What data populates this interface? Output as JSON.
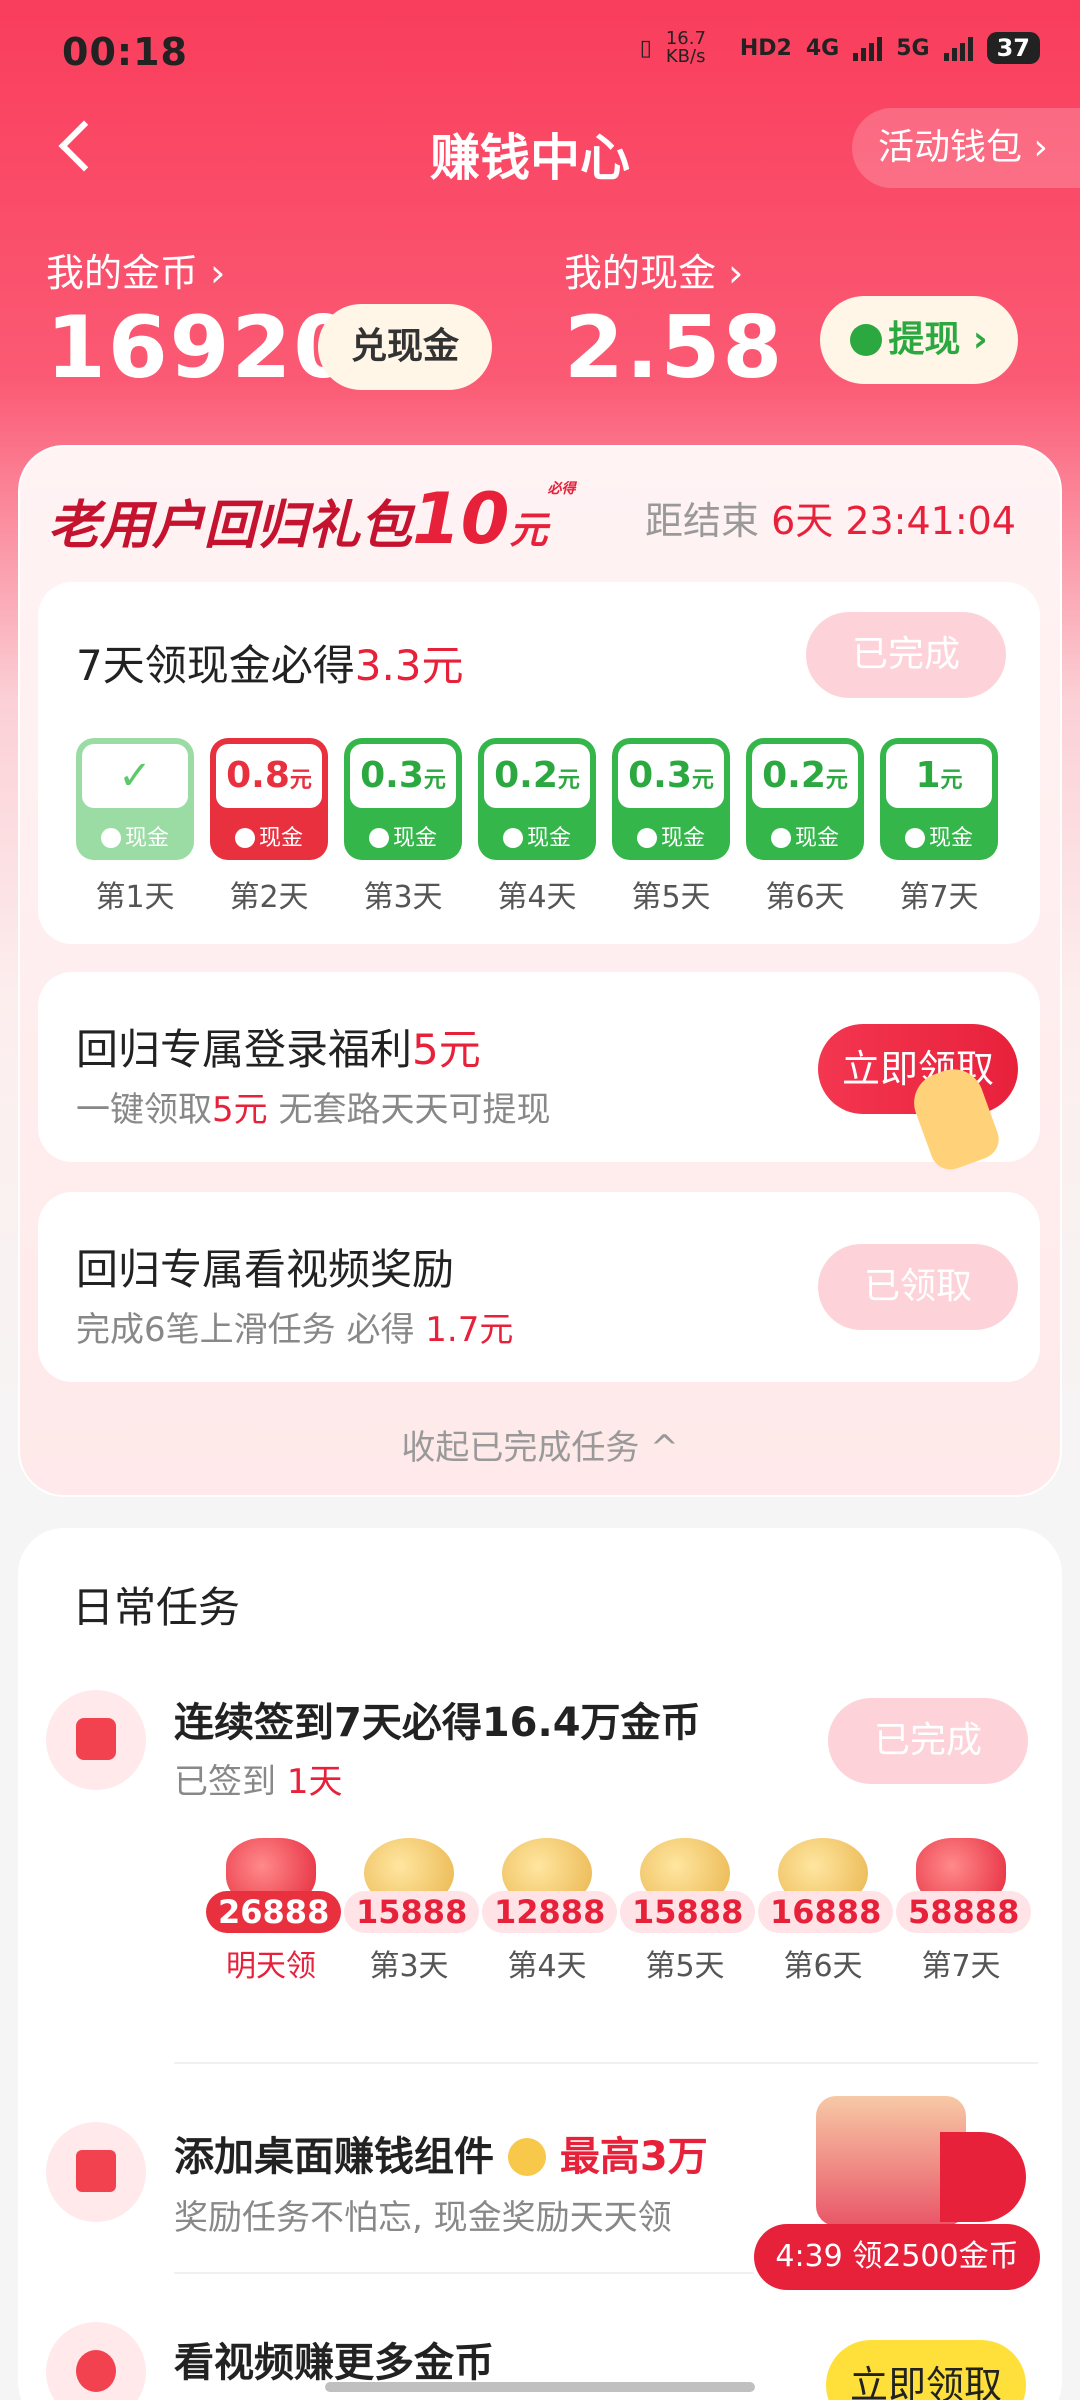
{
  "status_bar": {
    "time": "00:18",
    "net_speed": "16.7 KB/s",
    "hd": "HD2",
    "net1": "4G",
    "net2": "5G",
    "battery": "37"
  },
  "header": {
    "title": "赚钱中心",
    "wallet_label": "活动钱包 ›"
  },
  "balance": {
    "coins_label": "我的金币 ›",
    "coins_value": "16920",
    "exchange_label": "兑现金",
    "cash_label": "我的现金 ›",
    "cash_value": "2.58",
    "withdraw_label": "提现 ›"
  },
  "gift": {
    "title_prefix": "老用户回归礼包",
    "amount": "10",
    "yuan": "元",
    "bide": "必得",
    "timer_label": "距结束",
    "timer_value": "6天 23:41:04",
    "task1": {
      "title": "7天领现金必得",
      "title_amount": "3.3元",
      "button": "已完成",
      "days": [
        {
          "amount": "✓",
          "unit": "",
          "cash": "现金",
          "label": "第1天"
        },
        {
          "amount": "0.8",
          "unit": "元",
          "cash": "现金",
          "label": "第2天"
        },
        {
          "amount": "0.3",
          "unit": "元",
          "cash": "现金",
          "label": "第3天"
        },
        {
          "amount": "0.2",
          "unit": "元",
          "cash": "现金",
          "label": "第4天"
        },
        {
          "amount": "0.3",
          "unit": "元",
          "cash": "现金",
          "label": "第5天"
        },
        {
          "amount": "0.2",
          "unit": "元",
          "cash": "现金",
          "label": "第6天"
        },
        {
          "amount": "1",
          "unit": "元",
          "cash": "现金",
          "label": "第7天"
        }
      ]
    },
    "task2": {
      "title": "回归专属登录福利",
      "title_amount": "5元",
      "sub_pre": "一键领取",
      "sub_amount": "5元",
      "sub_post": " 无套路天天可提现",
      "button": "立即领取"
    },
    "task3": {
      "title": "回归专属看视频奖励",
      "sub_pre": "完成6笔上滑任务 必得 ",
      "sub_amount": "1.7元",
      "button": "已领取"
    },
    "collapse": "收起已完成任务 ^"
  },
  "daily": {
    "title": "日常任务",
    "checkin": {
      "title": "连续签到7天必得16.4万金币",
      "sub_pre": "已签到 ",
      "sub_amount": "1天",
      "button": "已完成",
      "coins": [
        {
          "amount": "26888",
          "label": "明天领"
        },
        {
          "amount": "15888",
          "label": "第3天"
        },
        {
          "amount": "12888",
          "label": "第4天"
        },
        {
          "amount": "15888",
          "label": "第5天"
        },
        {
          "amount": "16888",
          "label": "第6天"
        },
        {
          "amount": "58888",
          "label": "第7天"
        }
      ]
    },
    "widget": {
      "title": "添加桌面赚钱组件",
      "title_red": "最高3万",
      "sub": "奖励任务不怕忘, 现金奖励天天领",
      "timer": "4:39 领2500金币"
    },
    "video": {
      "title": "看视频赚更多金币",
      "button": "立即领取"
    }
  }
}
